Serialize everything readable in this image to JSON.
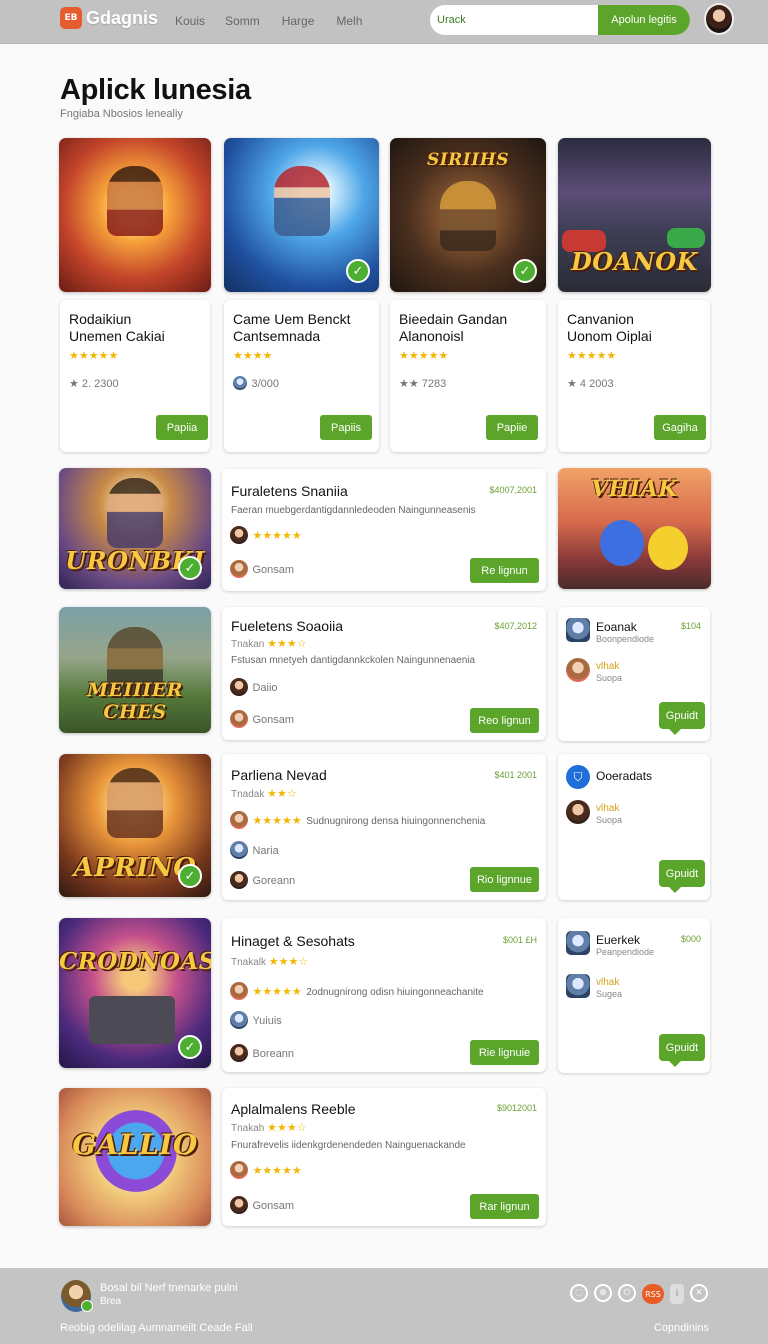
{
  "header": {
    "logo_badge": "EB",
    "logo_text": "Gdagnis",
    "nav": [
      "Kouis",
      "Somm",
      "Harge",
      "Melh"
    ],
    "search_value": "Urack",
    "search_button": "Apolun legitis"
  },
  "page": {
    "title": "Aplick lunesia",
    "subtitle": "Fngiaba Nbosios  lenealiy"
  },
  "top_cards": [
    {
      "line1": "Rodaikiun",
      "line2": "Unemen Cakiai",
      "stars": "★★★★★",
      "meta": "★ 2. 2300",
      "button": "Papiia"
    },
    {
      "line1": "Came Uem Benckt",
      "line2": "Cantsemnada",
      "stars": "★★★★",
      "meta": "3/000",
      "button": "Papiis"
    },
    {
      "line1": "Bieedain Gandan",
      "line2": "Alanonoisl",
      "stars": "★★★★★",
      "meta": "★★ 7283",
      "button": "Papiie"
    },
    {
      "line1": "Canvanion",
      "line2": "Uonom Oiplai",
      "stars": "★★★★★",
      "meta": "★ 4 2003",
      "button": "Gagiha"
    }
  ],
  "thumbs": [
    {
      "title": "",
      "check": true
    },
    {
      "title": "",
      "check": true
    },
    {
      "title": "SIRIIHS",
      "check": true
    },
    {
      "title": "DOANOK",
      "check": false
    },
    {
      "title": "URONBKI",
      "check": true
    },
    {
      "title": "VHIAK",
      "check": false
    },
    {
      "title": "MEIIIER CHES",
      "check": false
    },
    {
      "title": "APRINO",
      "check": true
    },
    {
      "title": "CRODNOAS",
      "check": true
    },
    {
      "title": "GALLIO",
      "check": false
    }
  ],
  "wide_cards": [
    {
      "title": "Furaletens Snaniia",
      "price": "$4007,2001",
      "sub": "",
      "stars_rating": "",
      "desc": "Faeran muebgerdantigdannledeoden Naingunneasenis",
      "row1_text": "",
      "row1_stars": "★★★★★",
      "row2_text": "Gonsam",
      "row3_text": "",
      "button": "Re lignun"
    },
    {
      "title": "Fueletens Soaoiia",
      "price": "$407,2012",
      "sub": "Tnakan",
      "stars_rating": "★★★☆",
      "desc": "Fstusan mnetyeh dantigdannkckolen Naingunnenaenia",
      "row1_text": "Daiio",
      "row1_stars": "",
      "row2_text": "Gonsam",
      "row3_text": "",
      "button": "Reo lignun"
    },
    {
      "title": "Parliena Nevad",
      "price": "$401 2001",
      "sub": "Tnadak",
      "stars_rating": "★★☆",
      "desc": "Sudnugnirong densa hiuingonnenchenia",
      "row1_text": "",
      "row1_stars": "★★★★★",
      "row2_text": "Naria",
      "row3_text": "Goreann",
      "button": "Rio lignnue"
    },
    {
      "title": "Hinaget & Sesohats",
      "price": "$001 £H",
      "sub": "Tnakalk",
      "stars_rating": "★★★☆",
      "desc": "2odnugnirong odisn hiuingonneachanite",
      "row1_text": "",
      "row1_stars": "★★★★★",
      "row2_text": "Yuiuis",
      "row3_text": "Boreann",
      "button": "Rie lignuie"
    },
    {
      "title": "Aplalmalens Reeble",
      "price": "$9012001",
      "sub": "Tnakah",
      "stars_rating": "★★★☆",
      "desc": "Fnurafrevelis iidenkgrdenendeden Nainguenackande",
      "row1_text": "",
      "row1_stars": "★★★★★",
      "row2_text": "Gonsam",
      "row3_text": "",
      "button": "Rar lignun"
    }
  ],
  "side_cards": [
    {
      "title": "Eoanak",
      "price": "$104",
      "title_sub": "Boonpendiode",
      "name": "vlhak",
      "name_sub": "Suopa",
      "button": "Gpuidt"
    },
    {
      "title": "Ooeradats",
      "price": "",
      "title_sub": "",
      "name": "vlhak",
      "name_sub": "Suopa",
      "button": "Gpuidt"
    },
    {
      "title": "Euerkek",
      "price": "$000",
      "title_sub": "Peanpendiode",
      "name": "vlhak",
      "name_sub": "Sugea",
      "button": "Gpuidt"
    }
  ],
  "footer": {
    "line1": "Bosal bil Nerf tnenarke pulni",
    "line2": "Brea",
    "bottom_left": "Reobig odelilag Aumnameilt Ceade Fall",
    "bottom_right": "Copndinins",
    "icons": [
      "settings-icon",
      "globe-icon",
      "power-icon",
      "rss-icon",
      "info-icon",
      "close-icon"
    ],
    "icon_labels": [
      "◌",
      "⊕",
      "⏻",
      "RSS",
      "i",
      "✕"
    ]
  },
  "colors": {
    "accent": "#5aa52a",
    "header": "#c2c2c2",
    "footer": "#c4c4c4",
    "star": "#f2b705",
    "logo": "#e65c2e"
  }
}
